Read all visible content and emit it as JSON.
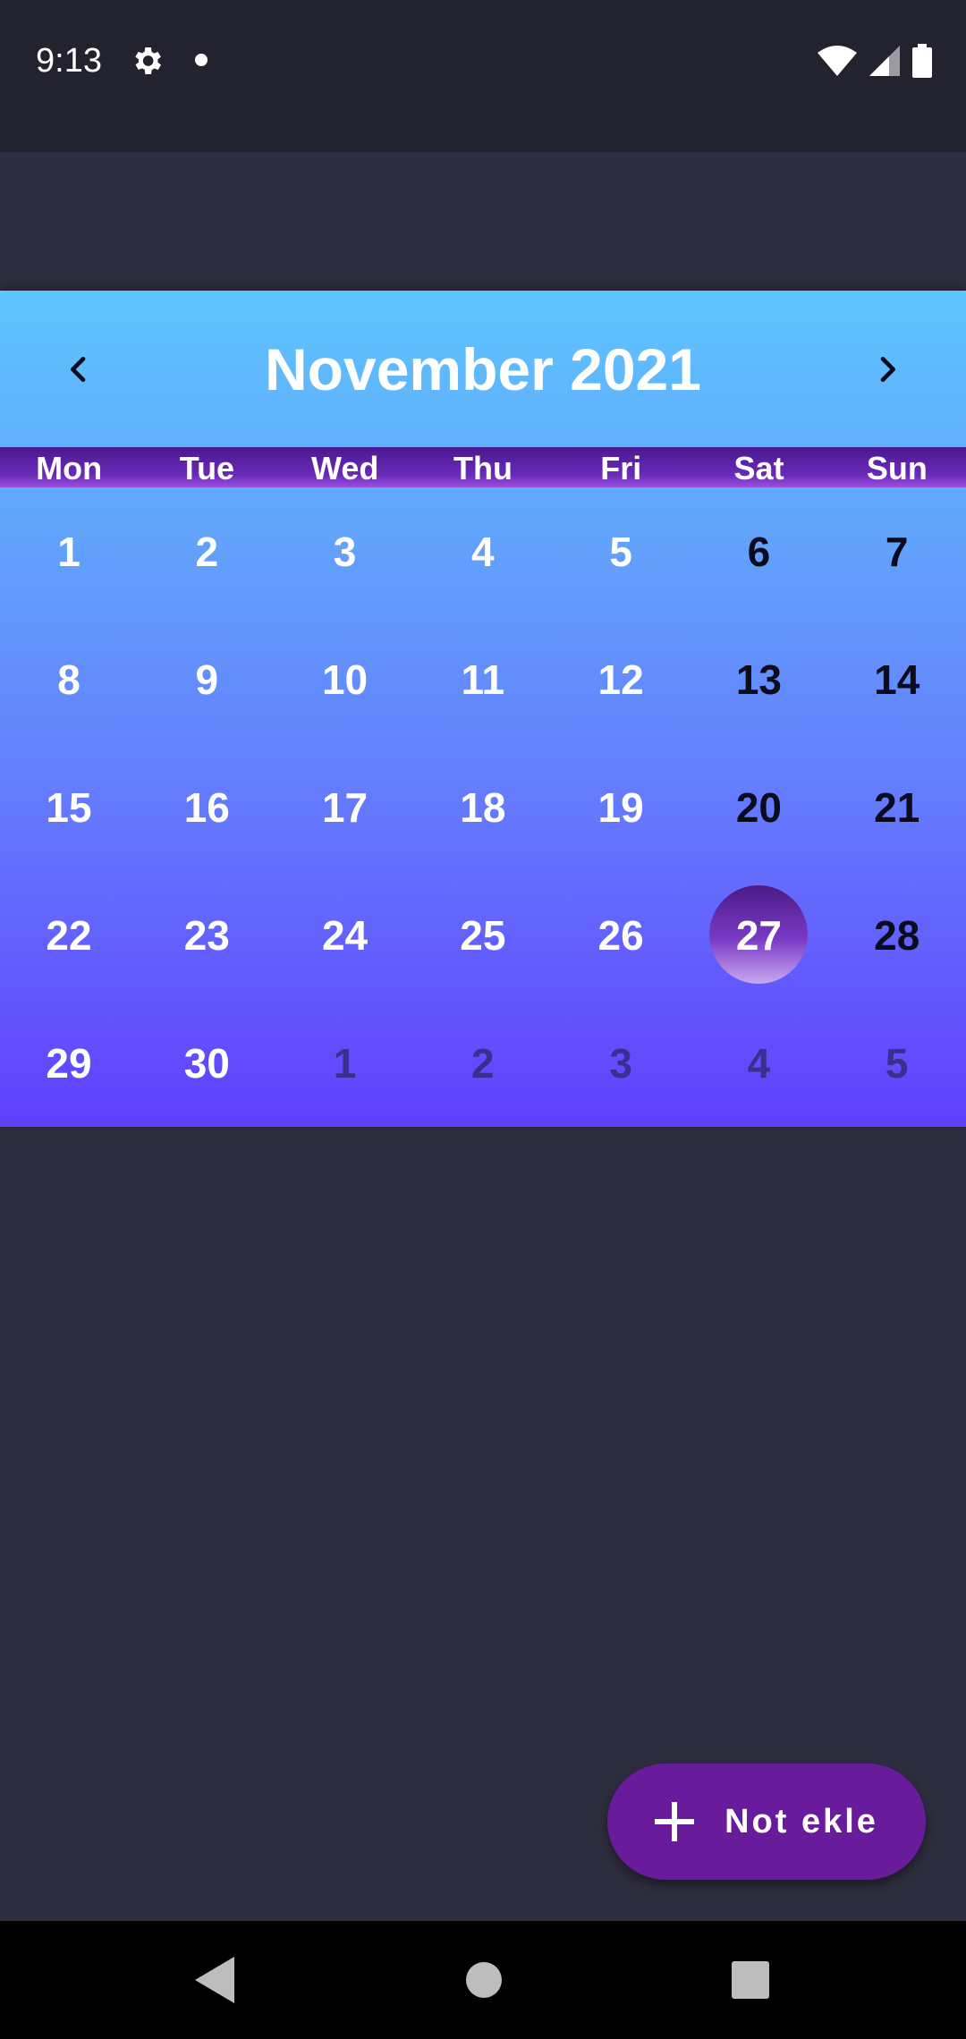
{
  "status_bar": {
    "time": "9:13",
    "icons": [
      "settings-gear-icon",
      "notification-dot-icon",
      "wifi-icon",
      "cell-signal-icon",
      "battery-icon"
    ]
  },
  "calendar": {
    "month_title": "November 2021",
    "prev_icon": "chevron-left-icon",
    "next_icon": "chevron-right-icon",
    "weekdays": [
      "Mon",
      "Tue",
      "Wed",
      "Thu",
      "Fri",
      "Sat",
      "Sun"
    ],
    "weeks": [
      [
        "1",
        "2",
        "3",
        "4",
        "5",
        "6",
        "7"
      ],
      [
        "8",
        "9",
        "10",
        "11",
        "12",
        "13",
        "14"
      ],
      [
        "15",
        "16",
        "17",
        "18",
        "19",
        "20",
        "21"
      ],
      [
        "22",
        "23",
        "24",
        "25",
        "26",
        "27",
        "28"
      ],
      [
        "29",
        "30",
        "1",
        "2",
        "3",
        "4",
        "5"
      ]
    ],
    "selected_day": "27",
    "colors": {
      "gradient_top": "#5ec5fd",
      "gradient_bottom": "#613ffd",
      "weekday_bar": "#6a2bb8",
      "selected_circle": "#7b3ac6",
      "weekend_text": "#0b0b1e",
      "outside_month_text": "#3a2f8f"
    }
  },
  "fab": {
    "label": "Not ekle",
    "icon": "plus-icon",
    "color": "#681b9a"
  },
  "navigation_bar": {
    "icons": [
      "back-triangle-icon",
      "home-circle-icon",
      "recents-square-icon"
    ]
  }
}
